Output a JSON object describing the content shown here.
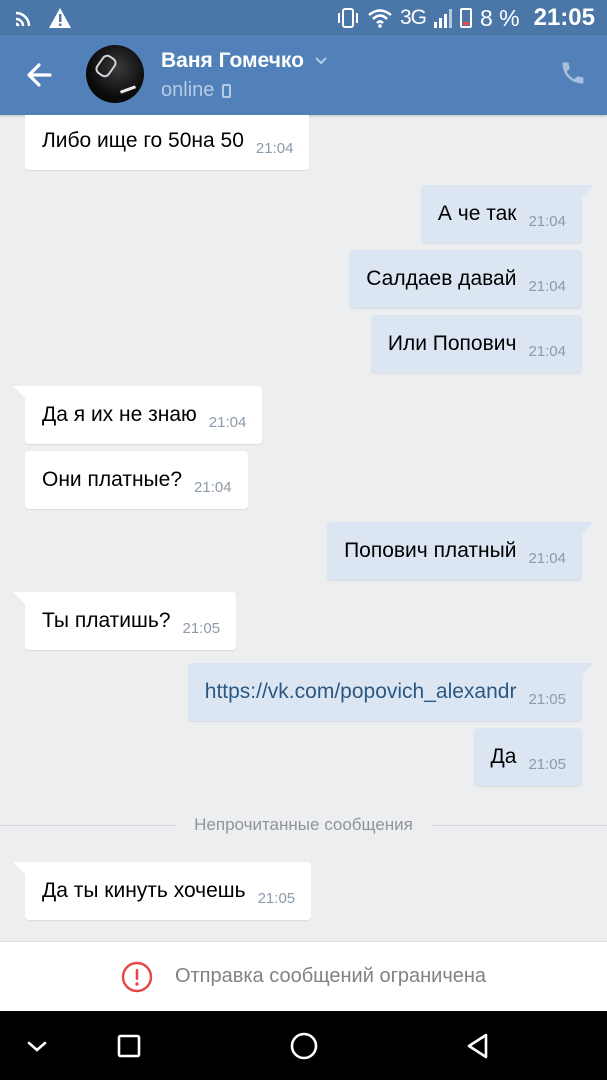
{
  "status_bar": {
    "network": "3G",
    "battery": "8 %",
    "time": "21:05"
  },
  "header": {
    "contact_name": "Ваня Гомечко",
    "status": "online"
  },
  "messages": [
    {
      "dir": "in",
      "text": "Либо ище го 50на 50",
      "time": "21:04"
    },
    {
      "dir": "out",
      "text": "А че так",
      "time": "21:04"
    },
    {
      "dir": "out",
      "text": "Салдаев давай",
      "time": "21:04"
    },
    {
      "dir": "out",
      "text": "Или Попович",
      "time": "21:04"
    },
    {
      "dir": "in",
      "text": "Да я их не знаю",
      "time": "21:04"
    },
    {
      "dir": "in",
      "text": "Они платные?",
      "time": "21:04"
    },
    {
      "dir": "out",
      "text": "Попович платный",
      "time": "21:04"
    },
    {
      "dir": "in",
      "text": "Ты платишь?",
      "time": "21:05"
    },
    {
      "dir": "out",
      "text": "https://vk.com/popovich_alexandr",
      "time": "21:05"
    },
    {
      "dir": "out",
      "text": "Да",
      "time": "21:05"
    },
    {
      "dir": "in",
      "text": "Да ты кинуть хочешь",
      "time": "21:05"
    }
  ],
  "unread_divider": "Непрочитанные сообщения",
  "restriction_notice": "Отправка сообщений ограничена",
  "icons": {
    "back": "arrow-left-icon",
    "call": "phone-icon",
    "notice": "exclamation-circle-icon",
    "nav": [
      "chevron-down-icon",
      "square-icon",
      "circle-icon",
      "triangle-back-icon"
    ]
  },
  "colors": {
    "header": "#5181b8",
    "status_bar": "#4a76a8",
    "chat_bg": "#edeef0",
    "incoming_bubble": "#ffffff",
    "outgoing_bubble": "#dce6f2",
    "link": "#2a5885",
    "alert_red": "#e64646"
  }
}
